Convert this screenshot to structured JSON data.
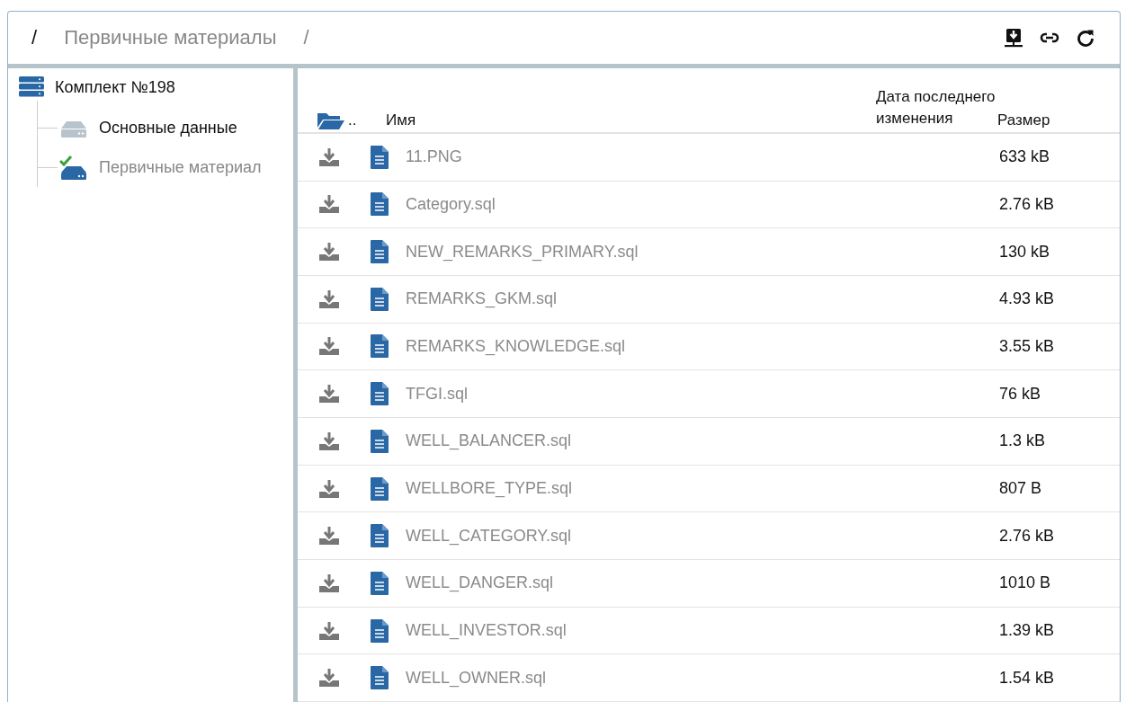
{
  "breadcrumb": [
    {
      "kind": "root",
      "text": "/"
    },
    {
      "kind": "folder",
      "text": "Первичные материалы"
    },
    {
      "kind": "separator",
      "text": "/"
    }
  ],
  "toolbar": [
    {
      "kind": "download"
    },
    {
      "kind": "link"
    },
    {
      "kind": "refresh"
    }
  ],
  "tree": {
    "label": "Комплект №198",
    "children": [
      {
        "label": "Основные данные",
        "selected": false
      },
      {
        "label": "Первичные материал",
        "selected": true
      }
    ]
  },
  "table": {
    "up": "..",
    "columns": [
      "Имя",
      "Дата последнего изменения",
      "Размер"
    ],
    "rows": [
      {
        "name": "11.PNG",
        "size": "633 kB"
      },
      {
        "name": "Category.sql",
        "size": "2.76 kB"
      },
      {
        "name": "NEW_REMARKS_PRIMARY.sql",
        "size": "130 kB"
      },
      {
        "name": "REMARKS_GKM.sql",
        "size": "4.93 kB"
      },
      {
        "name": "REMARKS_KNOWLEDGE.sql",
        "size": "3.55 kB"
      },
      {
        "name": "TFGI.sql",
        "size": "76 kB"
      },
      {
        "name": "WELL_BALANCER.sql",
        "size": "1.3 kB"
      },
      {
        "name": "WELLBORE_TYPE.sql",
        "size": "807 B"
      },
      {
        "name": "WELL_CATEGORY.sql",
        "size": "2.76 kB"
      },
      {
        "name": "WELL_DANGER.sql",
        "size": "1010 B"
      },
      {
        "name": "WELL_INVESTOR.sql",
        "size": "1.39 kB"
      },
      {
        "name": "WELL_OWNER.sql",
        "size": "1.54 kB"
      }
    ]
  }
}
